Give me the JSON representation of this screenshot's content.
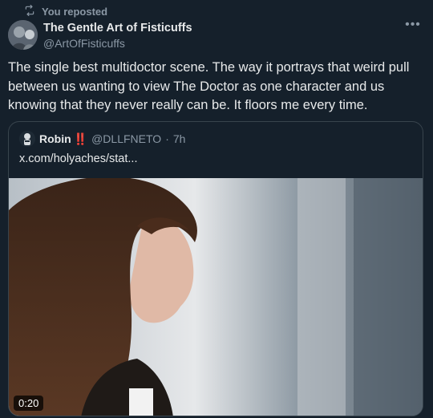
{
  "repost": {
    "label": "You reposted",
    "icon": "repost-icon"
  },
  "author": {
    "name": "The Gentle Art of Fisticuffs",
    "handle": "@ArtOfFisticuffs"
  },
  "more_icon": "more-options-icon",
  "post_text": "The single best multidoctor scene. The way it portrays that weird pull between us wanting to view The Doctor as one character and us knowing that they never really can be. It floors me every time.",
  "quote": {
    "name": "Robin",
    "badge": "‼️",
    "handle": "@DLLFNETO",
    "separator": "·",
    "time": "7h",
    "link": "x.com/holyaches/stat...",
    "video": {
      "duration": "0:20"
    }
  },
  "colors": {
    "background": "#15202b",
    "text": "#e7e9ea",
    "muted": "#8b98a5",
    "border": "#38444d",
    "badge": "#e0245e"
  }
}
